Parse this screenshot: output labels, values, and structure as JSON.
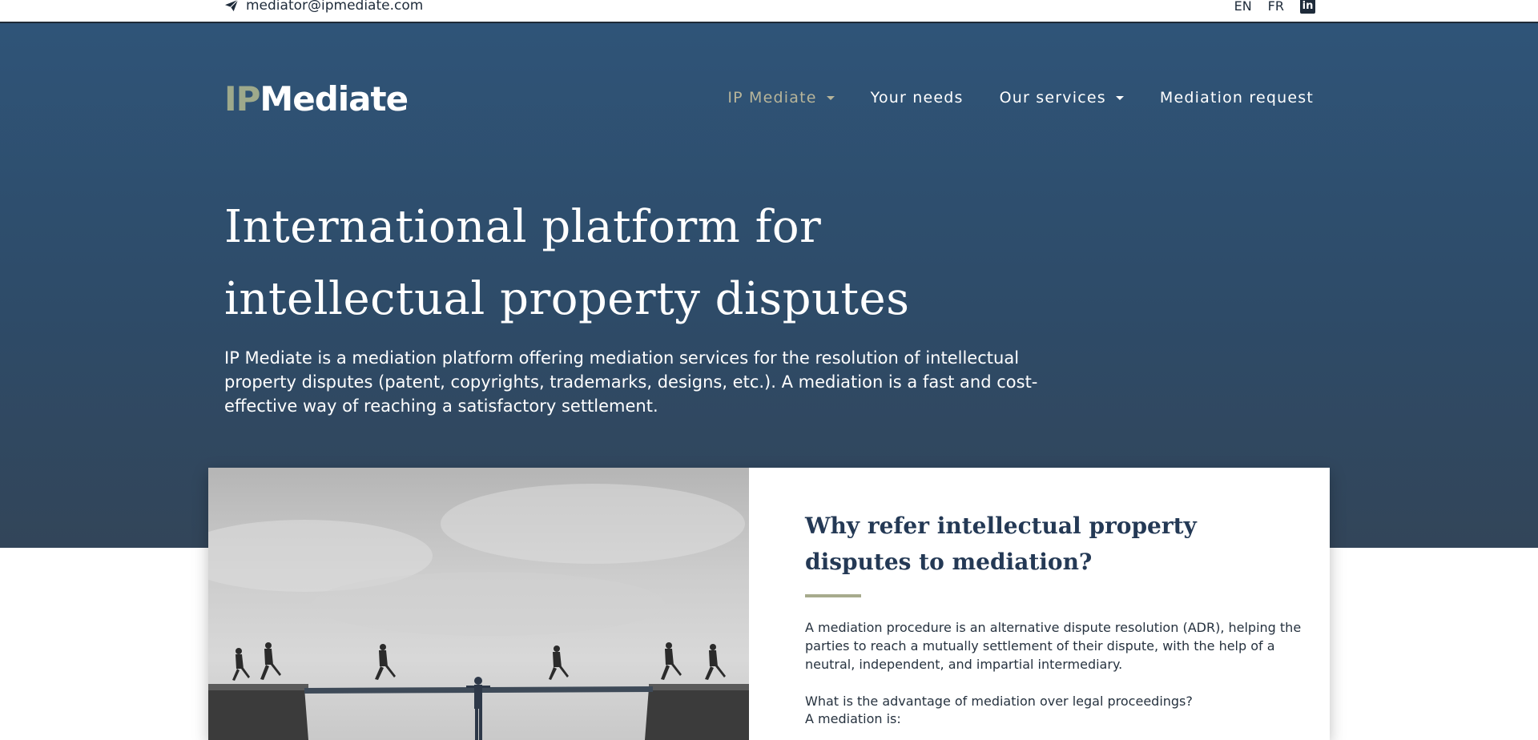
{
  "topbar": {
    "email": "mediator@ipmediate.com",
    "languages": [
      "EN",
      "FR"
    ],
    "linkedin_label": "in"
  },
  "brand": {
    "logo_prefix": "IP",
    "logo_suffix": "Mediate",
    "prefix_color": "#9ea98b"
  },
  "nav": {
    "items": [
      {
        "label": "IP Mediate",
        "dropdown": true,
        "active": true
      },
      {
        "label": "Your needs",
        "dropdown": false
      },
      {
        "label": "Our services",
        "dropdown": true
      },
      {
        "label": "Mediation request",
        "dropdown": false
      }
    ]
  },
  "hero": {
    "title_line1": "International platform for",
    "title_line2": "intellectual property disputes",
    "text_part1": "IP Mediate is a mediation platform offering mediation services for the resolution of intellectual property disputes (patent, copyrights, trademarks, designs, etc.). A mediation is a ",
    "text_fast": "fast",
    "text_and": " and ",
    "text_cost": "cost-effective",
    "text_part2": " way of reaching a satisfactory settlement."
  },
  "card": {
    "title": "Why refer intellectual property disputes to mediation?",
    "paragraph1": "A mediation procedure is an alternative dispute resolution (ADR), helping the parties to reach a mutually settlement of their dispute, with the help of a neutral, independent, and impartial intermediary.",
    "question": "What is the advantage of mediation over legal proceedings?",
    "mediation_is": "A mediation is:"
  },
  "colors": {
    "hero_top": "#2f5478",
    "hero_bottom": "#324559",
    "accent": "#a7ab8d",
    "heading": "#243955"
  },
  "icons": [
    "paper-plane-icon",
    "linkedin-icon",
    "chevron-down-icon"
  ]
}
